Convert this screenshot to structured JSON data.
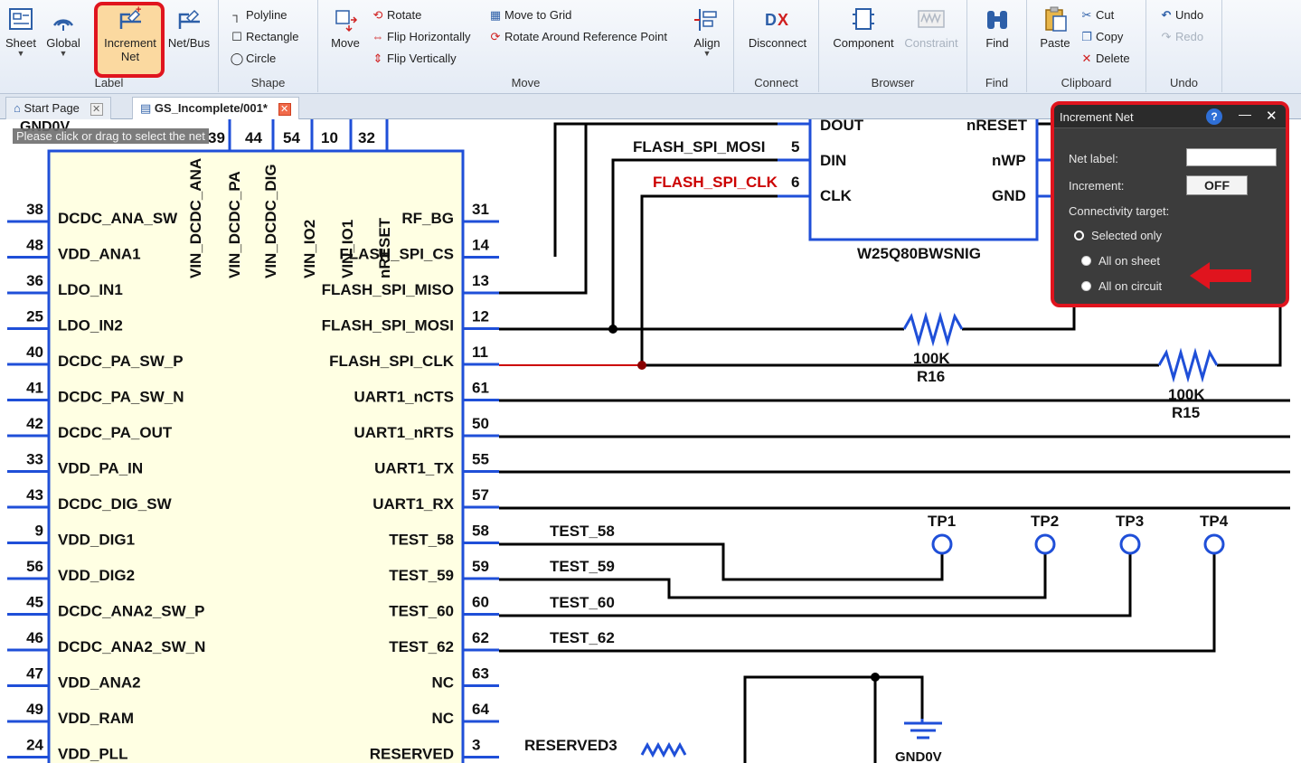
{
  "ribbon": {
    "groups": {
      "label": "Label",
      "shape": "Shape",
      "move": "Move",
      "connect": "Connect",
      "browser": "Browser",
      "find": "Find",
      "clipboard": "Clipboard",
      "undo": "Undo"
    },
    "sheet": "Sheet",
    "global": "Global",
    "increment_net_line1": "Increment",
    "increment_net_line2": "Net",
    "net_bus": "Net/Bus",
    "polyline": "Polyline",
    "rectangle": "Rectangle",
    "circle": "Circle",
    "move": "Move",
    "rotate": "Rotate",
    "flip_h": "Flip Horizontally",
    "flip_v": "Flip Vertically",
    "move_to_grid": "Move to Grid",
    "rotate_ref": "Rotate Around Reference Point",
    "align": "Align",
    "disconnect": "Disconnect",
    "component": "Component",
    "constraint": "Constraint",
    "find": "Find",
    "paste": "Paste",
    "cut": "Cut",
    "copy": "Copy",
    "delete": "Delete",
    "undo": "Undo",
    "redo": "Redo"
  },
  "tabs": [
    {
      "label": "Start Page"
    },
    {
      "label": "GS_Incomplete/001*"
    }
  ],
  "canvas": {
    "hint": "Please click or drag to select the net",
    "gnd_top": "GND0V",
    "top_pins": [
      "39",
      "44",
      "54",
      "10",
      "32"
    ],
    "vertical_pins": [
      "VIN_DCDC_ANA",
      "VIN_DCDC_PA",
      "VIN_DCDC_DIG",
      "VIN_IO2",
      "VIN_IO1",
      "nRESET"
    ],
    "left_pins": [
      {
        "num": "38",
        "name": "DCDC_ANA_SW"
      },
      {
        "num": "48",
        "name": "VDD_ANA1"
      },
      {
        "num": "36",
        "name": "LDO_IN1"
      },
      {
        "num": "25",
        "name": "LDO_IN2"
      },
      {
        "num": "40",
        "name": "DCDC_PA_SW_P"
      },
      {
        "num": "41",
        "name": "DCDC_PA_SW_N"
      },
      {
        "num": "42",
        "name": "DCDC_PA_OUT"
      },
      {
        "num": "33",
        "name": "VDD_PA_IN"
      },
      {
        "num": "43",
        "name": "DCDC_DIG_SW"
      },
      {
        "num": "9",
        "name": "VDD_DIG1"
      },
      {
        "num": "56",
        "name": "VDD_DIG2"
      },
      {
        "num": "45",
        "name": "DCDC_ANA2_SW_P"
      },
      {
        "num": "46",
        "name": "DCDC_ANA2_SW_N"
      },
      {
        "num": "47",
        "name": "VDD_ANA2"
      },
      {
        "num": "49",
        "name": "VDD_RAM"
      },
      {
        "num": "24",
        "name": "VDD_PLL"
      }
    ],
    "right_pins": [
      {
        "num": "31",
        "name": "RF_BG"
      },
      {
        "num": "14",
        "name": "FLASH_SPI_CS"
      },
      {
        "num": "13",
        "name": "FLASH_SPI_MISO"
      },
      {
        "num": "12",
        "name": "FLASH_SPI_MOSI"
      },
      {
        "num": "11",
        "name": "FLASH_SPI_CLK"
      },
      {
        "num": "61",
        "name": "UART1_nCTS"
      },
      {
        "num": "50",
        "name": "UART1_nRTS"
      },
      {
        "num": "55",
        "name": "UART1_TX"
      },
      {
        "num": "57",
        "name": "UART1_RX"
      },
      {
        "num": "58",
        "name": "TEST_58"
      },
      {
        "num": "59",
        "name": "TEST_59"
      },
      {
        "num": "60",
        "name": "TEST_60"
      },
      {
        "num": "62",
        "name": "TEST_62"
      },
      {
        "num": "63",
        "name": "NC"
      },
      {
        "num": "64",
        "name": "NC"
      },
      {
        "num": "3",
        "name": "RESERVED"
      }
    ],
    "net_labels": [
      "TEST_58",
      "TEST_59",
      "TEST_60",
      "TEST_62",
      "RESERVED3"
    ],
    "flash": {
      "mosi_label": "FLASH_SPI_MOSI",
      "clk_label": "FLASH_SPI_CLK",
      "pin5": "5",
      "pin6": "6",
      "dout": "DOUT",
      "din": "DIN",
      "clk": "CLK",
      "nreset": "nRESET",
      "nwp": "nWP",
      "gnd": "GND",
      "part": "W25Q80BWSNIG"
    },
    "resistors": [
      {
        "value": "100K",
        "ref": "R16"
      },
      {
        "value": "100K",
        "ref": "R15"
      }
    ],
    "test_points": [
      "TP1",
      "TP2",
      "TP3",
      "TP4"
    ],
    "gnd_bottom": "GND0V"
  },
  "dialog": {
    "title": "Increment Net",
    "net_label": "Net label:",
    "net_value": "",
    "increment_label": "Increment:",
    "increment_value": "OFF",
    "connectivity_label": "Connectivity target:",
    "options": [
      "Selected only",
      "All on sheet",
      "All on circuit"
    ],
    "selected_option": "Selected only"
  },
  "colors": {
    "highlight_red": "#e0141e",
    "component_blue": "#1f4fd8",
    "wire": "#000000",
    "net_red": "#cc0000"
  }
}
